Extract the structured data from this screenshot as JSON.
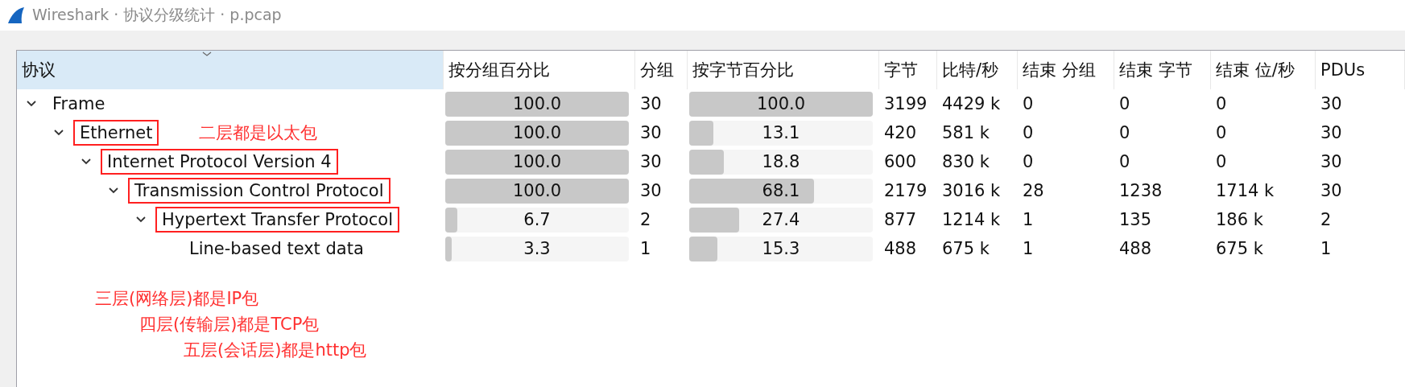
{
  "window": {
    "title": "Wireshark · 协议分级统计 · p.pcap"
  },
  "columns": [
    "协议",
    "按分组百分比",
    "分组",
    "按字节百分比",
    "字节",
    "比特/秒",
    "结束 分组",
    "结束 字节",
    "结束 位/秒",
    "PDUs"
  ],
  "rows": [
    {
      "name": "Frame",
      "expanded": true,
      "boxed": false,
      "pct_packets": {
        "text": "100.0",
        "level": 1.0
      },
      "packets": "30",
      "pct_bytes": {
        "text": "100.0",
        "level": 1.0
      },
      "bytes": "3199",
      "bits_s": "4429 k",
      "end_packets": "0",
      "end_bytes": "0",
      "end_bits": "0",
      "pdus": "30",
      "children": [
        {
          "name": "Ethernet",
          "expanded": true,
          "boxed": true,
          "note": "二层都是以太包",
          "pct_packets": {
            "text": "100.0",
            "level": 1.0
          },
          "packets": "30",
          "pct_bytes": {
            "text": "13.1",
            "level": 0.131
          },
          "bytes": "420",
          "bits_s": "581 k",
          "end_packets": "0",
          "end_bytes": "0",
          "end_bits": "0",
          "pdus": "30",
          "children": [
            {
              "name": "Internet Protocol Version 4",
              "expanded": true,
              "boxed": true,
              "pct_packets": {
                "text": "100.0",
                "level": 1.0
              },
              "packets": "30",
              "pct_bytes": {
                "text": "18.8",
                "level": 0.188
              },
              "bytes": "600",
              "bits_s": "830 k",
              "end_packets": "0",
              "end_bytes": "0",
              "end_bits": "0",
              "pdus": "30",
              "children": [
                {
                  "name": "Transmission Control Protocol",
                  "expanded": true,
                  "boxed": true,
                  "pct_packets": {
                    "text": "100.0",
                    "level": 1.0
                  },
                  "packets": "30",
                  "pct_bytes": {
                    "text": "68.1",
                    "level": 0.681
                  },
                  "bytes": "2179",
                  "bits_s": "3016 k",
                  "end_packets": "28",
                  "end_bytes": "1238",
                  "end_bits": "1714 k",
                  "pdus": "30",
                  "children": [
                    {
                      "name": "Hypertext Transfer Protocol",
                      "expanded": true,
                      "boxed": true,
                      "pct_packets": {
                        "text": "6.7",
                        "level": 0.067
                      },
                      "packets": "2",
                      "pct_bytes": {
                        "text": "27.4",
                        "level": 0.274
                      },
                      "bytes": "877",
                      "bits_s": "1214 k",
                      "end_packets": "1",
                      "end_bytes": "135",
                      "end_bits": "186 k",
                      "pdus": "2",
                      "children": [
                        {
                          "name": "Line-based text data",
                          "boxed": false,
                          "pct_packets": {
                            "text": "3.3",
                            "level": 0.033
                          },
                          "packets": "1",
                          "pct_bytes": {
                            "text": "15.3",
                            "level": 0.153
                          },
                          "bytes": "488",
                          "bits_s": "675 k",
                          "end_packets": "1",
                          "end_bytes": "488",
                          "end_bits": "675 k",
                          "pdus": "1"
                        }
                      ]
                    }
                  ]
                }
              ]
            }
          ]
        }
      ]
    }
  ],
  "notes": [
    "三层(网络层)都是IP包",
    "四层(传输层)都是TCP包",
    "五层(会话层)都是http包"
  ]
}
